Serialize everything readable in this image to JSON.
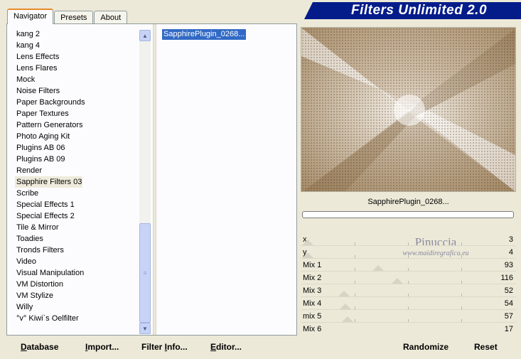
{
  "tabs": [
    {
      "label": "Navigator"
    },
    {
      "label": "Presets"
    },
    {
      "label": "About"
    }
  ],
  "banner": {
    "title": "Filters Unlimited 2.0",
    "color": "#041c8a"
  },
  "filters": [
    "kang 2",
    "kang 4",
    "Lens Effects",
    "Lens Flares",
    "Mock",
    "Noise Filters",
    "Paper Backgrounds",
    "Paper Textures",
    "Pattern Generators",
    "Photo Aging Kit",
    "Plugins AB 06",
    "Plugins AB 09",
    "Render",
    "Sapphire Filters 03",
    "Scribe",
    "Special Effects 1",
    "Special Effects 2",
    "Tile & Mirror",
    "Toadies",
    "Tronds Filters",
    "Video",
    "Visual Manipulation",
    "VM Distortion",
    "VM Stylize",
    "Willy",
    "°v° Kiwi`s Oelfilter"
  ],
  "selected_filter": "Sapphire Filters 03",
  "plugins": [
    "SapphirePlugin_0268..."
  ],
  "buttons": {
    "database": {
      "first": "D",
      "rest": "atabase"
    },
    "import": {
      "first": "I",
      "rest": "mport..."
    },
    "filter_info": {
      "pre": "Filter ",
      "first": "I",
      "rest": "nfo..."
    },
    "editor": {
      "first": "E",
      "rest": "ditor..."
    },
    "randomize": "Randomize",
    "reset": "Reset"
  },
  "preview": {
    "name": "SapphirePlugin_0268..."
  },
  "params": [
    {
      "label": "x",
      "value": "3"
    },
    {
      "label": "y",
      "value": "4"
    },
    {
      "label": "Mix 1",
      "value": "93"
    },
    {
      "label": "Mix 2",
      "value": "116"
    },
    {
      "label": "Mix 3",
      "value": "52"
    },
    {
      "label": "Mix 4",
      "value": "54"
    },
    {
      "label": "mix 5",
      "value": "57"
    },
    {
      "label": "Mix 6",
      "value": "17"
    }
  ],
  "watermark": {
    "name": "Pinuccia",
    "url": "www.maidiregrafica.eu"
  },
  "colors": {
    "accent": "#316ac5",
    "panel": "#ece9d8",
    "banner": "#041c8a"
  }
}
